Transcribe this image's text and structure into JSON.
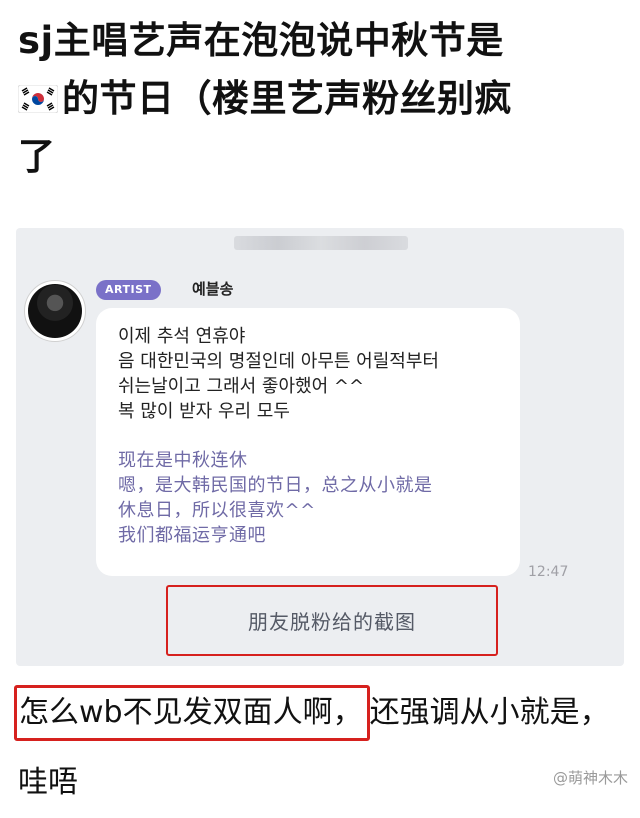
{
  "post": {
    "title_line1": "sj主唱艺声在泡泡说中秋节是",
    "title_line2": "的节日（楼里艺声粉丝别疯",
    "title_line3": "了",
    "flag_icon": "south-korea-flag-icon"
  },
  "screenshot": {
    "badge": "ARTIST",
    "username": "예블송",
    "ko_lines": [
      "이제 추석 연휴야",
      "음 대한민국의 명절인데 아무튼 어릴적부터",
      "쉬는날이고 그래서 좋아했어 ^^",
      "복 많이 받자 우리 모두"
    ],
    "zh_lines": [
      "现在是中秋连休",
      "嗯，是大韩民国的节日，总之从小就是",
      "休息日，所以很喜欢^^",
      "我们都福运亨通吧"
    ],
    "time": "12:47"
  },
  "caption": "朋友脱粉给的截图",
  "comment": {
    "highlighted": "怎么wb不见发双面人啊，",
    "rest": "还强调从小就是，",
    "line2": "哇唔"
  },
  "watermark": "@萌神木木",
  "colors": {
    "accent_red": "#d6211e",
    "badge_purple": "#7a71c8",
    "translation_purple": "#6f6aa6"
  }
}
